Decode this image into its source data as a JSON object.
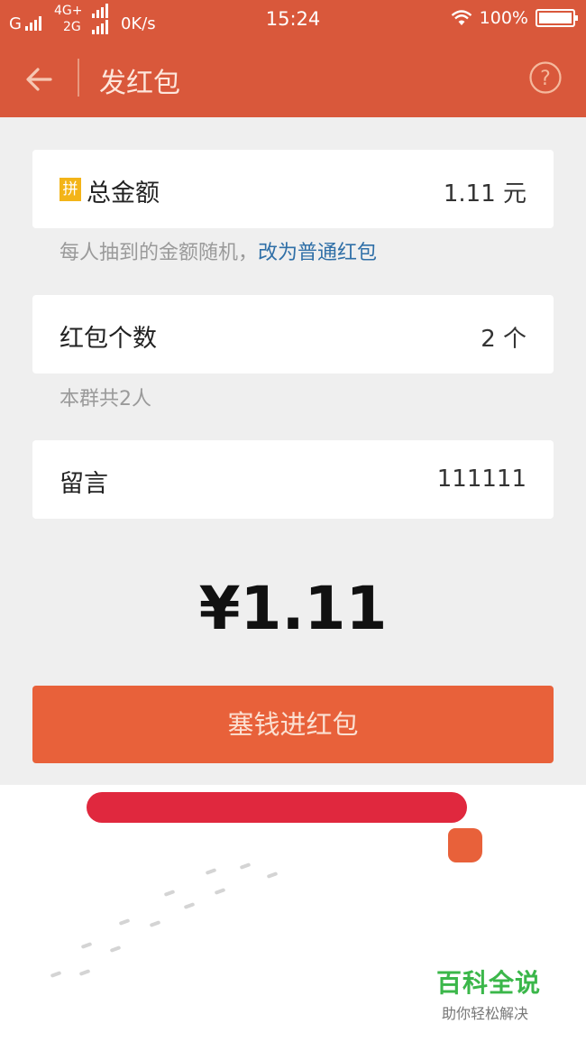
{
  "status_bar": {
    "carrier1": "G",
    "network2_top": "4G+",
    "network2_bottom": "2G",
    "speed": "0K/s",
    "time": "15:24",
    "battery": "100%"
  },
  "nav": {
    "title": "发红包",
    "back_icon": "arrow-left-icon",
    "help_icon": "question-circle-icon"
  },
  "total_amount": {
    "badge": "拼",
    "label": "总金额",
    "value": "1.11 元"
  },
  "random_hint": {
    "text": "每人抽到的金额随机，",
    "link": "改为普通红包"
  },
  "count": {
    "label": "红包个数",
    "value": "2 个"
  },
  "group_hint": "本群共2人",
  "message": {
    "label": "留言",
    "value": "111111"
  },
  "display_amount": "¥1.11",
  "submit_label": "塞钱进红包",
  "watermark": {
    "title": "百科全说",
    "subtitle": "助你轻松解决"
  },
  "colors": {
    "header": "#d9583b",
    "button": "#e8613a",
    "link": "#2f6fa7",
    "badge": "#f3b418"
  }
}
